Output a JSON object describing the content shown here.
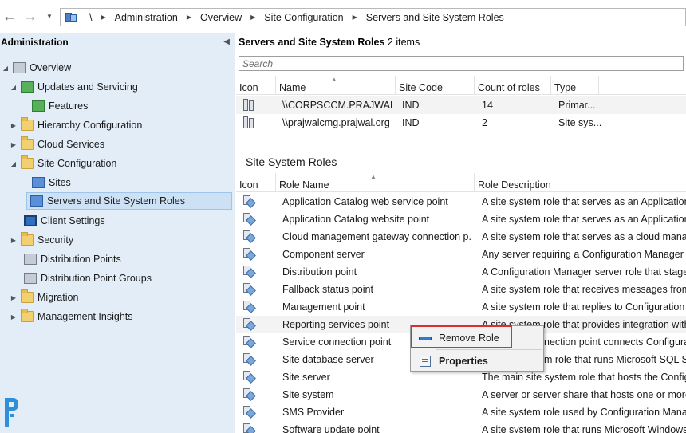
{
  "nav": {
    "back": "←",
    "forward": "→"
  },
  "breadcrumb": {
    "root": "\\",
    "items": [
      "Administration",
      "Overview",
      "Site Configuration",
      "Servers and Site System Roles"
    ]
  },
  "left_pane": {
    "title": "Administration",
    "tree": [
      {
        "label": "Overview",
        "icon": "overview-icon"
      },
      {
        "label": "Updates and Servicing",
        "icon": "updates-icon"
      },
      {
        "label": "Features",
        "icon": "features-icon"
      },
      {
        "label": "Hierarchy Configuration",
        "icon": "folder-icon"
      },
      {
        "label": "Cloud Services",
        "icon": "folder-icon"
      },
      {
        "label": "Site Configuration",
        "icon": "folder-icon"
      },
      {
        "label": "Sites",
        "icon": "sites-icon"
      },
      {
        "label": "Servers and Site System Roles",
        "icon": "servers-icon"
      },
      {
        "label": "Client Settings",
        "icon": "monitor-icon"
      },
      {
        "label": "Security",
        "icon": "folder-icon"
      },
      {
        "label": "Distribution Points",
        "icon": "distribution-icon"
      },
      {
        "label": "Distribution Point Groups",
        "icon": "distribution-icon"
      },
      {
        "label": "Migration",
        "icon": "folder-icon"
      },
      {
        "label": "Management Insights",
        "icon": "folder-icon"
      }
    ]
  },
  "servers": {
    "title": "Servers and Site System Roles",
    "count_label": "2 items",
    "search_placeholder": "Search",
    "columns": [
      "Icon",
      "Name",
      "Site Code",
      "Count of roles",
      "Type"
    ],
    "rows": [
      {
        "name": "\\\\CORPSCCM.PRAJWAL....",
        "site_code": "IND",
        "count": "14",
        "type": "Primar..."
      },
      {
        "name": "\\\\prajwalcmg.prajwal.org",
        "site_code": "IND",
        "count": "2",
        "type": "Site sys..."
      }
    ]
  },
  "roles": {
    "title": "Site System Roles",
    "columns": [
      "Icon",
      "Role Name",
      "Role Description"
    ],
    "rows": [
      {
        "name": "Application Catalog web service point",
        "desc": "A site system role that serves as an Application C"
      },
      {
        "name": "Application Catalog website point",
        "desc": "A site system role that serves as an Application C"
      },
      {
        "name": "Cloud management gateway connection p...",
        "desc": "A site system role that serves as a cloud manage"
      },
      {
        "name": "Component server",
        "desc": "Any server requiring a Configuration Manager se"
      },
      {
        "name": "Distribution point",
        "desc": "A Configuration Manager server role that stages"
      },
      {
        "name": "Fallback status point",
        "desc": "A site system role that receives messages from C"
      },
      {
        "name": "Management point",
        "desc": "A site system role that replies to Configuration M"
      },
      {
        "name": "Reporting services point",
        "desc": "A site system role that  provides integration with"
      },
      {
        "name": "Service connection point",
        "desc": "nection point connects Configurati"
      },
      {
        "name": "Site database server",
        "desc": "m role that runs Microsoft SQL Serve"
      },
      {
        "name": "Site server",
        "desc": "The main site system role that hosts the Configu"
      },
      {
        "name": "Site system",
        "desc": "A server or server share that hosts one or more s"
      },
      {
        "name": "SMS Provider",
        "desc": "A site system role used by Configuration Manag"
      },
      {
        "name": "Software update point",
        "desc": "A site system role that runs Microsoft Windows S"
      }
    ]
  },
  "context_menu": {
    "items": [
      {
        "label": "Remove Role",
        "icon": "remove-icon"
      },
      {
        "label": "Properties",
        "icon": "properties-icon"
      }
    ]
  },
  "colors": {
    "highlight": "#d9302c",
    "left_pane_bg": "#e3edf8",
    "selected_bg": "#cde1f5"
  }
}
